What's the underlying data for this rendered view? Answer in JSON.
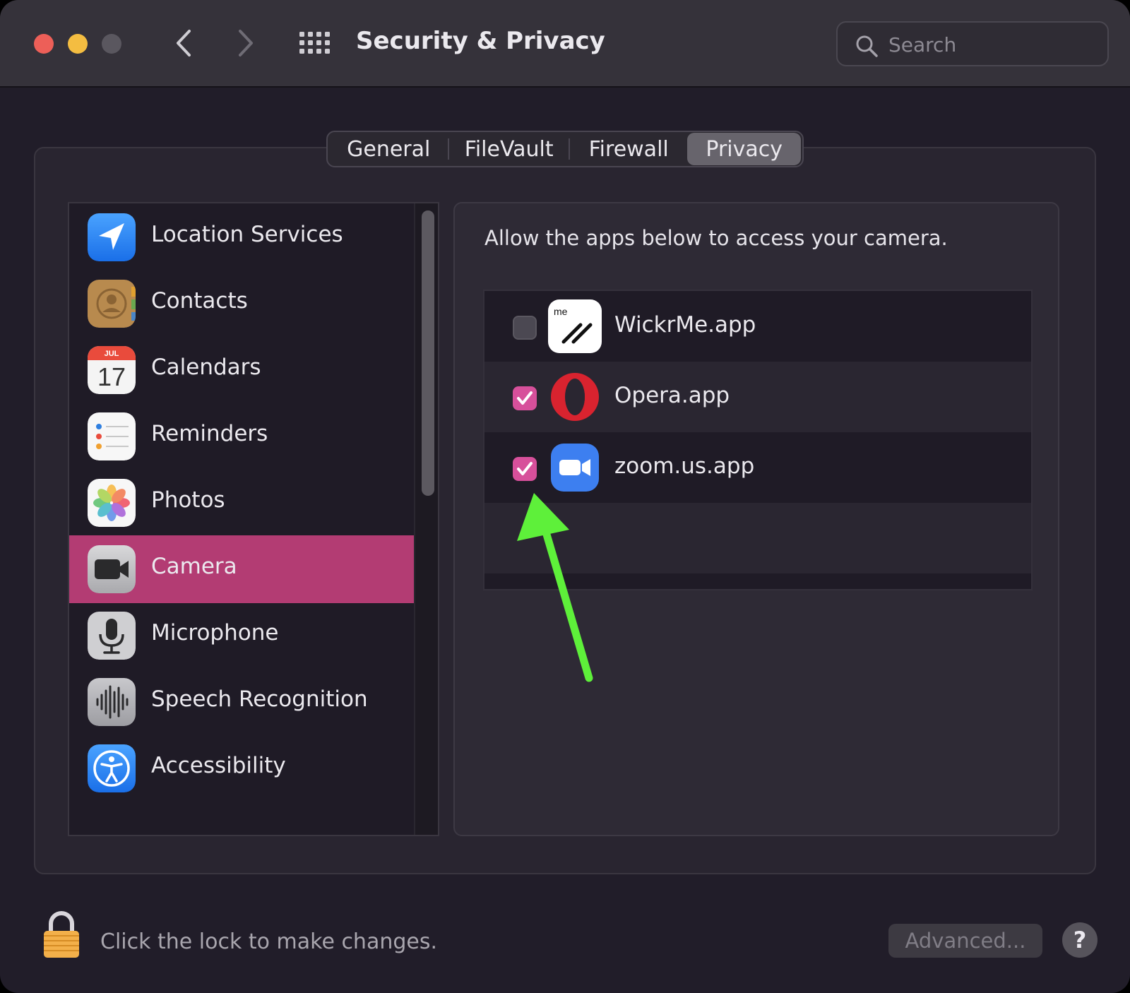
{
  "window": {
    "title": "Security & Privacy"
  },
  "toolbar": {
    "search_placeholder": "Search"
  },
  "tabs": [
    {
      "label": "General",
      "selected": false
    },
    {
      "label": "FileVault",
      "selected": false
    },
    {
      "label": "Firewall",
      "selected": false
    },
    {
      "label": "Privacy",
      "selected": true
    }
  ],
  "sidebar": {
    "items": [
      {
        "label": "Location Services",
        "icon": "location-arrow-icon",
        "selected": false
      },
      {
        "label": "Contacts",
        "icon": "contacts-book-icon",
        "selected": false
      },
      {
        "label": "Calendars",
        "icon": "calendar-icon",
        "selected": false,
        "icon_month": "JUL",
        "icon_day": "17"
      },
      {
        "label": "Reminders",
        "icon": "reminders-list-icon",
        "selected": false
      },
      {
        "label": "Photos",
        "icon": "photos-flower-icon",
        "selected": false
      },
      {
        "label": "Camera",
        "icon": "camera-icon",
        "selected": true
      },
      {
        "label": "Microphone",
        "icon": "microphone-icon",
        "selected": false
      },
      {
        "label": "Speech Recognition",
        "icon": "waveform-icon",
        "selected": false
      },
      {
        "label": "Accessibility",
        "icon": "accessibility-icon",
        "selected": false
      }
    ]
  },
  "pane": {
    "description": "Allow the apps below to access your camera.",
    "apps": [
      {
        "name": "WickrMe.app",
        "checked": false,
        "icon": "wickrme-icon",
        "icon_text": "me"
      },
      {
        "name": "Opera.app",
        "checked": true,
        "icon": "opera-icon"
      },
      {
        "name": "zoom.us.app",
        "checked": true,
        "icon": "zoom-icon"
      }
    ]
  },
  "footer": {
    "lock_text": "Click the lock to make changes.",
    "advanced_label": "Advanced...",
    "help_label": "?"
  },
  "colors": {
    "accent": "#b33c73",
    "checkbox_on": "#d7509b",
    "annotation_arrow": "#5ef03a"
  }
}
